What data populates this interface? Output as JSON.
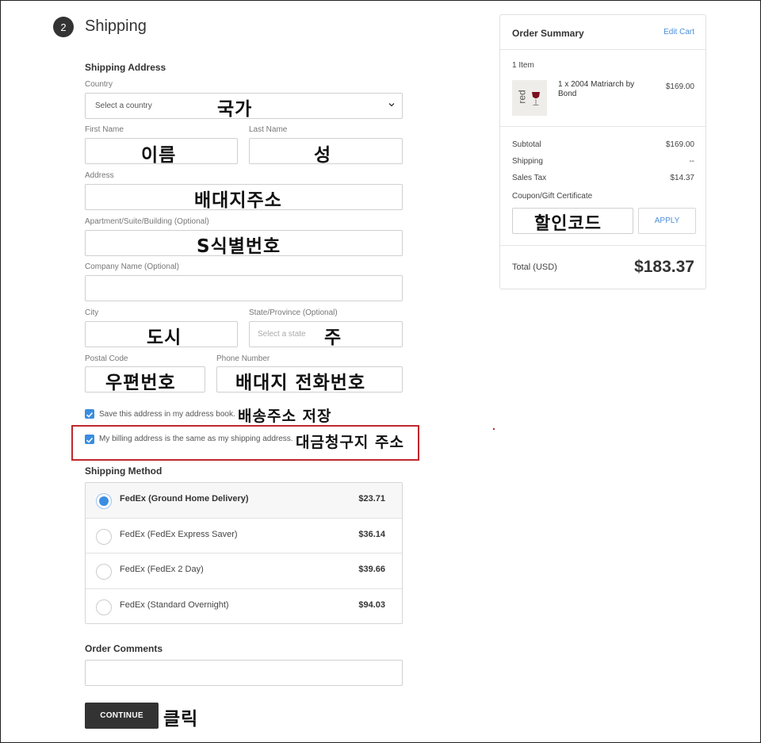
{
  "header": {
    "step_number": "2",
    "title": "Shipping"
  },
  "shipping_address": {
    "heading": "Shipping Address",
    "country": {
      "label": "Country",
      "value": "Select a country",
      "note": "국가"
    },
    "first_name": {
      "label": "First Name",
      "value": "",
      "note": "이름"
    },
    "last_name": {
      "label": "Last Name",
      "value": "",
      "note": "성"
    },
    "address": {
      "label": "Address",
      "value": "",
      "note": "배대지주소"
    },
    "apartment": {
      "label": "Apartment/Suite/Building (Optional)",
      "value": "",
      "note": "S식별번호"
    },
    "company": {
      "label": "Company Name (Optional)",
      "value": ""
    },
    "city": {
      "label": "City",
      "value": "",
      "note": "도시"
    },
    "state": {
      "label": "State/Province (Optional)",
      "placeholder": "Select a state",
      "note": "주"
    },
    "postal_code": {
      "label": "Postal Code",
      "value": "",
      "note": "우편번호"
    },
    "phone": {
      "label": "Phone Number",
      "value": "",
      "note": "배대지 전화번호"
    }
  },
  "options": {
    "save_address": {
      "label": "Save this address in my address book.",
      "checked": true,
      "note": "배송주소 저장"
    },
    "billing_same": {
      "label": "My billing address is the same as my shipping address.",
      "checked": true,
      "note": "대금청구지 주소"
    }
  },
  "shipping_method": {
    "heading": "Shipping Method",
    "methods": [
      {
        "name": "FedEx (Ground Home Delivery)",
        "price": "$23.71",
        "selected": true
      },
      {
        "name": "FedEx (FedEx Express Saver)",
        "price": "$36.14",
        "selected": false
      },
      {
        "name": "FedEx (FedEx 2 Day)",
        "price": "$39.66",
        "selected": false
      },
      {
        "name": "FedEx (Standard Overnight)",
        "price": "$94.03",
        "selected": false
      }
    ]
  },
  "order_comments": {
    "heading": "Order Comments",
    "value": ""
  },
  "continue": {
    "label": "CONTINUE",
    "note": "클릭"
  },
  "order_summary": {
    "title": "Order Summary",
    "edit_cart": "Edit Cart",
    "item_count": "1 Item",
    "item": {
      "thumb_text": "red",
      "name": "1 x 2004 Matriarch by Bond",
      "price": "$169.00"
    },
    "subtotal": {
      "label": "Subtotal",
      "value": "$169.00"
    },
    "shipping": {
      "label": "Shipping",
      "value": "--"
    },
    "sales_tax": {
      "label": "Sales Tax",
      "value": "$14.37"
    },
    "coupon": {
      "label": "Coupon/Gift Certificate",
      "note": "할인코드",
      "apply_label": "APPLY"
    },
    "total": {
      "label": "Total (USD)",
      "value": "$183.37"
    }
  },
  "colors": {
    "accent": "#3a8de0",
    "highlight": "#c0282d",
    "button": "#333333",
    "link": "#4a90d9"
  }
}
